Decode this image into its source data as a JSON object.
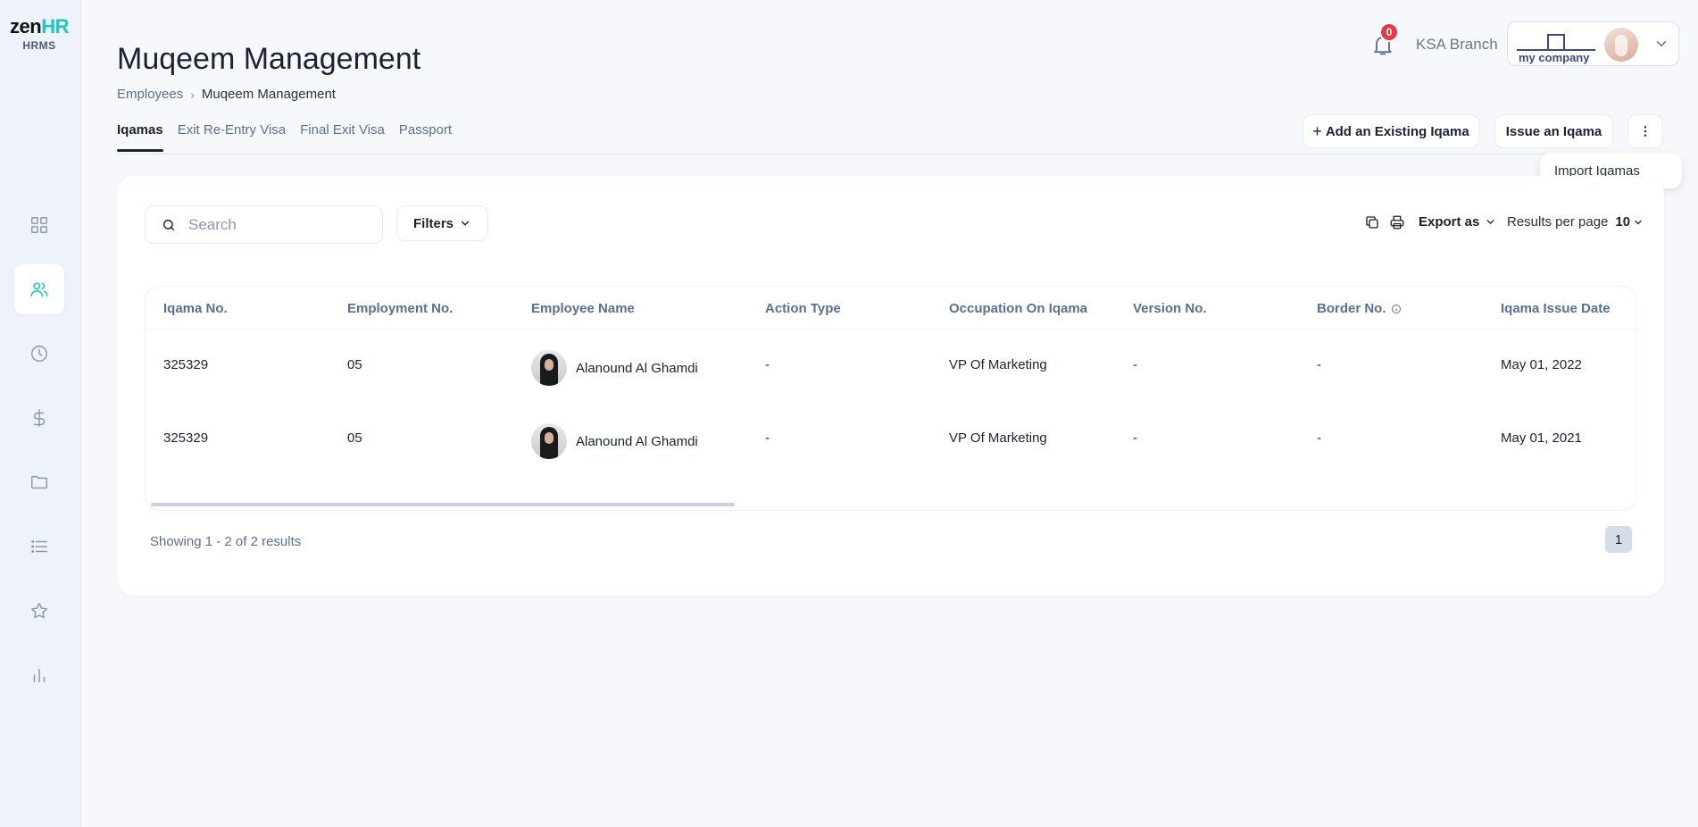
{
  "app": {
    "brand_zen": "zen",
    "brand_hr": "HR",
    "brand_sub": "HRMS"
  },
  "sidebar": {
    "items": [
      {
        "name": "dashboard",
        "icon": "grid-icon"
      },
      {
        "name": "employees",
        "icon": "users-icon",
        "active": true
      },
      {
        "name": "time",
        "icon": "clock-icon"
      },
      {
        "name": "payroll",
        "icon": "dollar-icon"
      },
      {
        "name": "documents",
        "icon": "folder-icon"
      },
      {
        "name": "lists",
        "icon": "list-icon"
      },
      {
        "name": "performance",
        "icon": "star-icon"
      },
      {
        "name": "reports",
        "icon": "bar-chart-icon"
      }
    ]
  },
  "header": {
    "title": "Muqeem Management",
    "breadcrumb": {
      "parent": "Employees",
      "current": "Muqeem Management"
    },
    "notifications_count": "0",
    "branch": "KSA Branch",
    "company_name": "my company"
  },
  "tabs": [
    {
      "label": "Iqamas",
      "active": true
    },
    {
      "label": "Exit Re-Entry Visa"
    },
    {
      "label": "Final Exit Visa"
    },
    {
      "label": "Passport"
    }
  ],
  "actions": {
    "add_existing": "Add an Existing Iqama",
    "issue": "Issue an Iqama",
    "dropdown_item": "Import Iqamas"
  },
  "toolbar": {
    "search_placeholder": "Search",
    "filters_label": "Filters",
    "export_label": "Export as",
    "results_per_page_label": "Results per page",
    "results_per_page_value": "10"
  },
  "table": {
    "columns": [
      "Iqama No.",
      "Employment No.",
      "Employee Name",
      "Action Type",
      "Occupation On Iqama",
      "Version No.",
      "Border No.",
      "Iqama Issue Date"
    ],
    "rows": [
      {
        "iqama_no": "325329",
        "employment_no": "05",
        "employee_name": "Alanound Al Ghamdi",
        "action_type": "-",
        "occupation": "VP Of Marketing",
        "version_no": "-",
        "border_no": "-",
        "issue_date": "May 01, 2022"
      },
      {
        "iqama_no": "325329",
        "employment_no": "05",
        "employee_name": "Alanound Al Ghamdi",
        "action_type": "-",
        "occupation": "VP Of Marketing",
        "version_no": "-",
        "border_no": "-",
        "issue_date": "May 01, 2021"
      }
    ]
  },
  "footer": {
    "showing": "Showing 1 - 2 of 2 results",
    "page": "1"
  },
  "colors": {
    "accent": "#1cc7c1",
    "badge": "#e63946",
    "muted_text": "#5b6f92",
    "sidebar_bg": "#eef2f9"
  }
}
